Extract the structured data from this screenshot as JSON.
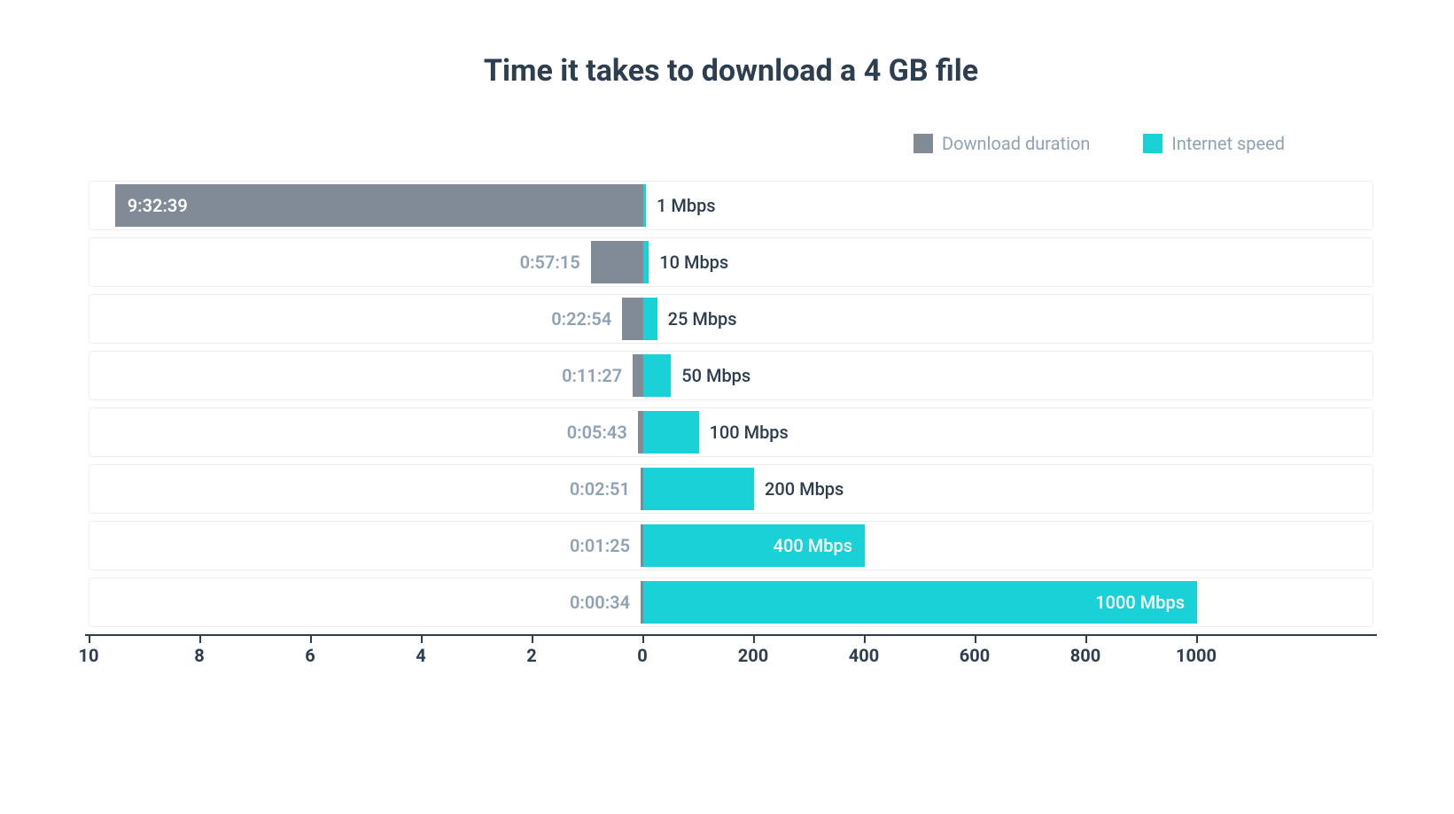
{
  "title": "Time it takes to download a 4 GB file",
  "legend": {
    "series_left": "Download duration",
    "series_right": "Internet speed"
  },
  "colors": {
    "duration": "#808b96",
    "speed": "#1ad1d8",
    "text_muted": "#8fa2b5",
    "text": "#2c3e50"
  },
  "axis_left": {
    "min": 0,
    "max": 10,
    "ticks": [
      10,
      8,
      6,
      4,
      2,
      0
    ]
  },
  "axis_right": {
    "min": 0,
    "max": 1000,
    "ticks": [
      0,
      200,
      400,
      600,
      800,
      1000
    ]
  },
  "rows": [
    {
      "duration_label": "9:32:39",
      "duration_hours": 9.54,
      "speed_label": "1 Mbps",
      "speed_mbps": 1
    },
    {
      "duration_label": "0:57:15",
      "duration_hours": 0.95,
      "speed_label": "10 Mbps",
      "speed_mbps": 10
    },
    {
      "duration_label": "0:22:54",
      "duration_hours": 0.38,
      "speed_label": "25 Mbps",
      "speed_mbps": 25
    },
    {
      "duration_label": "0:11:27",
      "duration_hours": 0.19,
      "speed_label": "50 Mbps",
      "speed_mbps": 50
    },
    {
      "duration_label": "0:05:43",
      "duration_hours": 0.1,
      "speed_label": "100 Mbps",
      "speed_mbps": 100
    },
    {
      "duration_label": "0:02:51",
      "duration_hours": 0.05,
      "speed_label": "200 Mbps",
      "speed_mbps": 200
    },
    {
      "duration_label": "0:01:25",
      "duration_hours": 0.02,
      "speed_label": "400 Mbps",
      "speed_mbps": 400
    },
    {
      "duration_label": "0:00:34",
      "duration_hours": 0.01,
      "speed_label": "1000 Mbps",
      "speed_mbps": 1000
    }
  ],
  "chart_data": {
    "type": "bar",
    "title": "Time it takes to download a 4 GB file",
    "orientation": "horizontal-diverging",
    "series": [
      {
        "name": "Download duration",
        "unit": "hours",
        "labels": [
          "9:32:39",
          "0:57:15",
          "0:22:54",
          "0:11:27",
          "0:05:43",
          "0:02:51",
          "0:01:25",
          "0:00:34"
        ],
        "values": [
          9.54,
          0.95,
          0.38,
          0.19,
          0.1,
          0.05,
          0.02,
          0.01
        ],
        "axis": {
          "min": 0,
          "max": 10,
          "ticks": [
            0,
            2,
            4,
            6,
            8,
            10
          ]
        }
      },
      {
        "name": "Internet speed",
        "unit": "Mbps",
        "labels": [
          "1 Mbps",
          "10 Mbps",
          "25 Mbps",
          "50 Mbps",
          "100 Mbps",
          "200 Mbps",
          "400 Mbps",
          "1000 Mbps"
        ],
        "values": [
          1,
          10,
          25,
          50,
          100,
          200,
          400,
          1000
        ],
        "axis": {
          "min": 0,
          "max": 1000,
          "ticks": [
            0,
            200,
            400,
            600,
            800,
            1000
          ]
        }
      }
    ]
  }
}
